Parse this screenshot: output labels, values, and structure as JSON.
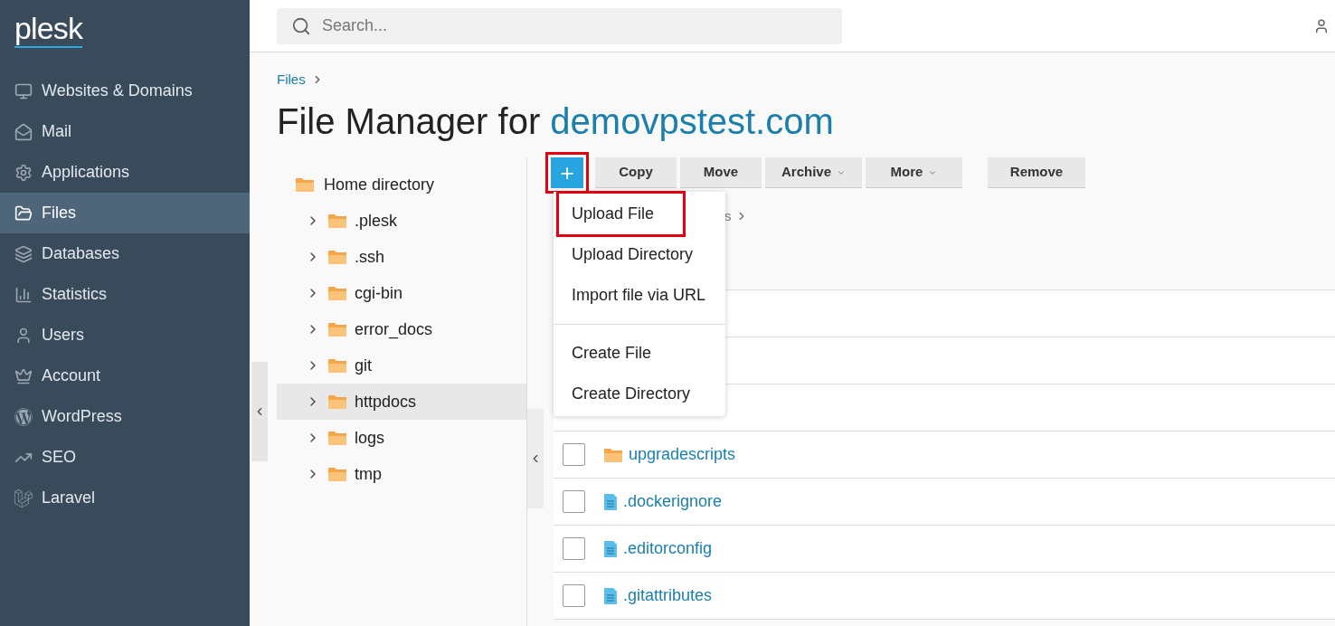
{
  "sidebar": {
    "logo": "plesk",
    "items": [
      {
        "label": "Websites & Domains",
        "selected": false
      },
      {
        "label": "Mail",
        "selected": false
      },
      {
        "label": "Applications",
        "selected": false
      },
      {
        "label": "Files",
        "selected": true
      },
      {
        "label": "Databases",
        "selected": false
      },
      {
        "label": "Statistics",
        "selected": false
      },
      {
        "label": "Users",
        "selected": false
      },
      {
        "label": "Account",
        "selected": false
      },
      {
        "label": "WordPress",
        "selected": false
      },
      {
        "label": "SEO",
        "selected": false
      },
      {
        "label": "Laravel",
        "selected": false
      }
    ]
  },
  "header": {
    "search": {
      "placeholder": "Search..."
    }
  },
  "breadcrumb": [
    "Files"
  ],
  "title": {
    "text": "File Manager for ",
    "domain": "demovpstest.com"
  },
  "tree": {
    "label": "Home directory",
    "children": [
      {
        "label": ".plesk",
        "expanded": false,
        "selected": false
      },
      {
        "label": ".ssh",
        "expanded": false,
        "selected": false
      },
      {
        "label": "cgi-bin",
        "expanded": false,
        "selected": false
      },
      {
        "label": "error_docs",
        "expanded": false,
        "selected": false
      },
      {
        "label": "git",
        "expanded": false,
        "selected": false
      },
      {
        "label": "httpdocs",
        "expanded": false,
        "selected": true
      },
      {
        "label": "logs",
        "expanded": false,
        "selected": false
      },
      {
        "label": "tmp",
        "expanded": false,
        "selected": false
      }
    ]
  },
  "toolbar": {
    "add_button": {
      "label": "+",
      "highlighted": true
    },
    "buttons": [
      {
        "label": "Copy",
        "dropdown": false
      },
      {
        "label": "Move",
        "dropdown": false
      },
      {
        "label": "Archive",
        "dropdown": true
      },
      {
        "label": "More",
        "dropdown": true
      },
      {
        "label": "Remove",
        "dropdown": false
      }
    ]
  },
  "path_fragment": "s",
  "add_menu": {
    "groups": [
      [
        {
          "label": "Upload File",
          "highlighted": true
        },
        {
          "label": "Upload Directory",
          "highlighted": false
        },
        {
          "label": "Import file via URL",
          "highlighted": false
        }
      ],
      [
        {
          "label": "Create File",
          "highlighted": false
        },
        {
          "label": "Create Directory",
          "highlighted": false
        }
      ]
    ]
  },
  "files": [
    {
      "name": "upgradescripts",
      "kind": "folder",
      "checked": false
    },
    {
      "name": ".dockerignore",
      "kind": "file",
      "checked": false
    },
    {
      "name": ".editorconfig",
      "kind": "file",
      "checked": false
    },
    {
      "name": ".gitattributes",
      "kind": "file",
      "checked": false
    }
  ]
}
